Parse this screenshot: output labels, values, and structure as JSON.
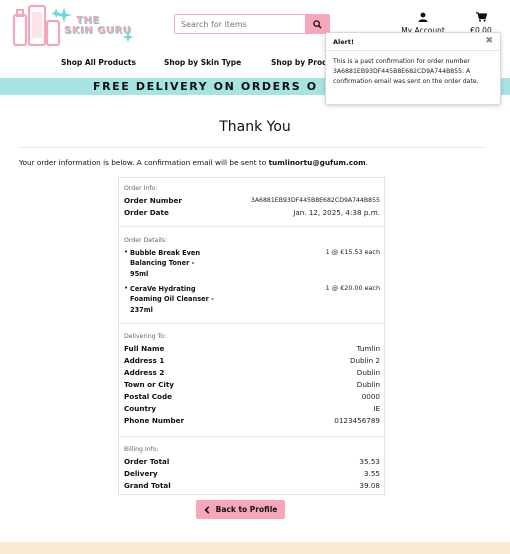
{
  "brand": {
    "line1": "THE",
    "line2": "SKIN GURU"
  },
  "search": {
    "placeholder": "Search for items"
  },
  "header": {
    "account_label": "My Account",
    "cart_total": "€0.00"
  },
  "nav": {
    "items": [
      "Shop All Products",
      "Shop by Skin Type",
      "Shop by Produ"
    ]
  },
  "banner": {
    "text": "FREE DELIVERY ON ORDERS O"
  },
  "alert": {
    "title": "Alert!",
    "message": "This is a past confirmation for order number 3A6881EB93DF445B8E682CD9A744B855. A confirmation email was sent on the order date."
  },
  "page": {
    "title": "Thank You",
    "intro_prefix": "Your order information is below. A confirmation email will be sent to ",
    "email": "tumlinortu@gufum.com",
    "intro_suffix": "."
  },
  "order_info": {
    "label": "Order Info:",
    "order_number_label": "Order Number",
    "order_number": "3A6881EB93DF445B8E682CD9A744B855",
    "order_date_label": "Order Date",
    "order_date": "Jan. 12, 2025, 4:38 p.m."
  },
  "order_details": {
    "label": "Order Details:",
    "items": [
      {
        "name": "Bubble Break Even Balancing Toner - 95ml",
        "qty_price": "1 @ €15.53 each"
      },
      {
        "name": "CeraVe Hydrating Foaming Oil Cleanser - 237ml",
        "qty_price": "1 @ €20.00 each"
      }
    ]
  },
  "delivery": {
    "label": "Delivering To:",
    "rows": [
      {
        "label": "Full Name",
        "value": "Tumlin"
      },
      {
        "label": "Address 1",
        "value": "Dublin 2"
      },
      {
        "label": "Address 2",
        "value": "Dublin"
      },
      {
        "label": "Town or City",
        "value": "Dublin"
      },
      {
        "label": "Postal Code",
        "value": "0000"
      },
      {
        "label": "Country",
        "value": "IE"
      },
      {
        "label": "Phone Number",
        "value": "0123456789"
      }
    ]
  },
  "billing": {
    "label": "Billing Info:",
    "rows": [
      {
        "label": "Order Total",
        "value": "35.53"
      },
      {
        "label": "Delivery",
        "value": "3.55"
      },
      {
        "label": "Grand Total",
        "value": "39.08"
      }
    ]
  },
  "back_button": {
    "label": "Back to Profile"
  },
  "colors": {
    "accent_pink": "#f6a6b8",
    "banner_teal": "#a6e3e3",
    "footer_cream": "#fbead2"
  }
}
